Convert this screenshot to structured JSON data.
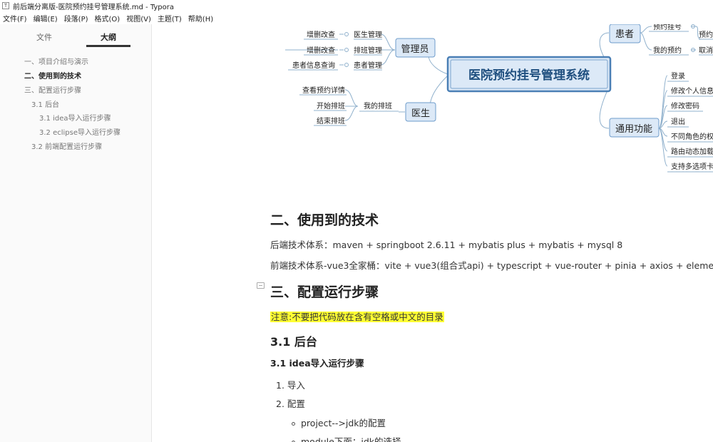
{
  "window": {
    "title": "前后端分离版-医院预约挂号管理系统.md - Typora",
    "app_icon": "T"
  },
  "menu": [
    "文件(F)",
    "编辑(E)",
    "段落(P)",
    "格式(O)",
    "视图(V)",
    "主题(T)",
    "帮助(H)"
  ],
  "sidebar": {
    "tabs": {
      "files": "文件",
      "outline": "大纲"
    },
    "outline": [
      "一、项目介绍与演示",
      "二、使用到的技术",
      "三、配置运行步骤",
      "3.1 后台",
      "3.1 idea导入运行步骤",
      "3.2 eclipse导入运行步骤",
      "3.2 前端配置运行步骤"
    ]
  },
  "mindmap": {
    "root": "医院预约挂号管理系统",
    "admin": {
      "label": "管理员",
      "children": [
        "医生管理",
        "排班管理",
        "患者管理"
      ],
      "leaves": [
        "增删改查",
        "增删改查",
        "患者信息查询"
      ]
    },
    "doctor": {
      "label": "医生",
      "child": "我的排班",
      "leaves": [
        "查看预约详情",
        "开始排班",
        "结束排班"
      ]
    },
    "patient": {
      "label": "患者",
      "children": [
        "预约挂号",
        "我的预约"
      ],
      "leaves": [
        "预约",
        "取消"
      ]
    },
    "common": {
      "label": "通用功能",
      "children": [
        "登录",
        "修改个人信息",
        "修改密码",
        "退出",
        "不同角色的权",
        "路由动态加载",
        "支持多选项卡"
      ]
    }
  },
  "doc": {
    "h_tech": "二、使用到的技术",
    "backend": "后端技术体系：maven + springboot 2.6.11 + mybatis plus + mybatis  + mysql 8",
    "frontend": "前端技术体系-vue3全家桶：vite + vue3(组合式api) + typescript + vue-router + pinia + axios + element-plus",
    "h_config": "三、配置运行步骤",
    "note": "注意:不要把代码放在含有空格或中文的目录",
    "h_backend": "3.1 后台",
    "h_idea": "3.1 idea导入运行步骤",
    "steps": [
      "1. 导入",
      "2. 配置"
    ],
    "sub_steps": [
      "project-->jdk的配置",
      "module下面：jdk的选择"
    ]
  }
}
